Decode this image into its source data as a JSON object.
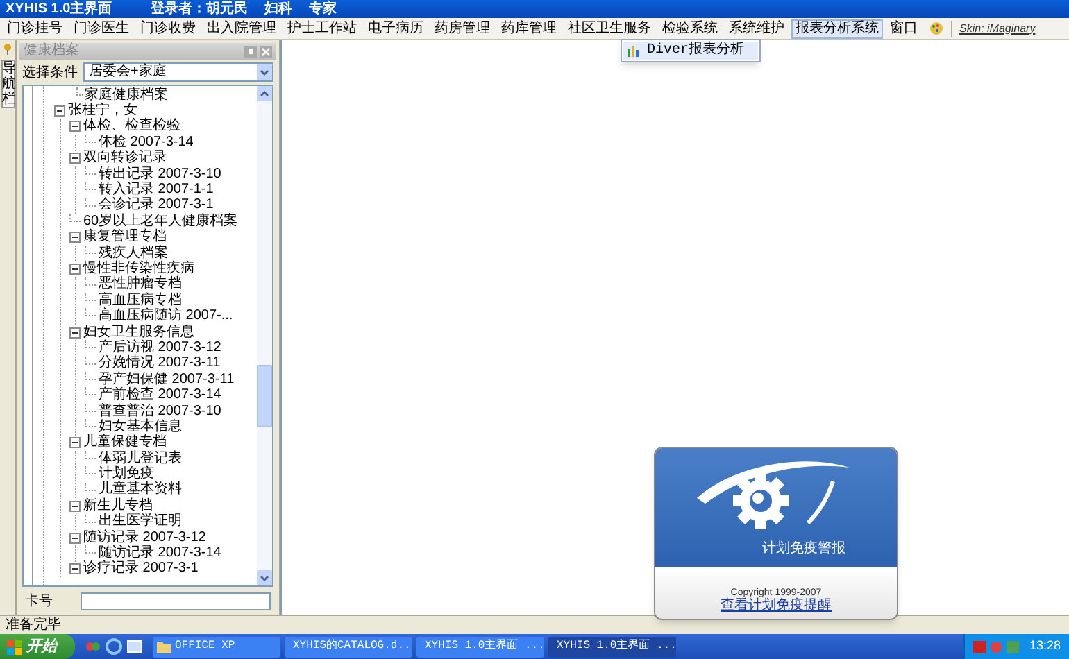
{
  "window": {
    "title": "XYHIS 1.0主界面",
    "login": "登录者：胡元民",
    "department": "妇科",
    "role": "专家"
  },
  "menu": [
    {
      "label": "门诊挂号",
      "selected": false
    },
    {
      "label": "门诊医生",
      "selected": false
    },
    {
      "label": "门诊收费",
      "selected": false
    },
    {
      "label": "出入院管理",
      "selected": false
    },
    {
      "label": "护士工作站",
      "selected": false
    },
    {
      "label": "电子病历",
      "selected": false
    },
    {
      "label": "药房管理",
      "selected": false
    },
    {
      "label": "药库管理",
      "selected": false
    },
    {
      "label": "社区卫生服务",
      "selected": false
    },
    {
      "label": "检验系统",
      "selected": false
    },
    {
      "label": "系统维护",
      "selected": false
    },
    {
      "label": "报表分析系统",
      "selected": true
    },
    {
      "label": "窗口",
      "selected": false
    }
  ],
  "skin_link": "Skin: iMaginary",
  "dropdown": {
    "items": [
      {
        "label": "Diver报表分析"
      }
    ]
  },
  "side_strip": {
    "label": "导航栏"
  },
  "panel": {
    "title": "健康档案",
    "condition_label": "选择条件",
    "condition_value": "居委会+家庭",
    "tree_tail": "家庭健康档案",
    "tree": [
      {
        "label": "张桂宁，女",
        "expanded": true,
        "children": [
          {
            "label": "体检、检查检验",
            "expanded": true,
            "children": [
              {
                "label": "体检 2007-3-14"
              }
            ]
          },
          {
            "label": "双向转诊记录",
            "expanded": true,
            "children": [
              {
                "label": "转出记录 2007-3-10"
              },
              {
                "label": "转入记录 2007-1-1"
              },
              {
                "label": "会诊记录 2007-3-1"
              }
            ]
          },
          {
            "label": "60岁以上老年人健康档案"
          },
          {
            "label": "康复管理专档",
            "expanded": true,
            "children": [
              {
                "label": "残疾人档案"
              }
            ]
          },
          {
            "label": "慢性非传染性疾病",
            "expanded": true,
            "children": [
              {
                "label": "恶性肿瘤专档"
              },
              {
                "label": "高血压病专档"
              },
              {
                "label": "高血压病随访 2007-..."
              }
            ]
          },
          {
            "label": "妇女卫生服务信息",
            "expanded": true,
            "children": [
              {
                "label": "产后访视 2007-3-12"
              },
              {
                "label": "分娩情况 2007-3-11"
              },
              {
                "label": "孕产妇保健 2007-3-11"
              },
              {
                "label": "产前检查 2007-3-14"
              },
              {
                "label": "普查普治 2007-3-10"
              },
              {
                "label": "妇女基本信息"
              }
            ]
          },
          {
            "label": "儿童保健专档",
            "expanded": true,
            "children": [
              {
                "label": "体弱儿登记表"
              },
              {
                "label": "计划免疫"
              },
              {
                "label": "儿童基本资料"
              }
            ]
          },
          {
            "label": "新生儿专档",
            "expanded": true,
            "children": [
              {
                "label": "出生医学证明"
              }
            ]
          },
          {
            "label": "随访记录 2007-3-12",
            "expanded": true,
            "children": [
              {
                "label": "随访记录 2007-3-14"
              }
            ]
          },
          {
            "label": "诊疗记录 2007-3-1",
            "expanded": true
          }
        ]
      }
    ],
    "card_label": "卡号"
  },
  "splash": {
    "title": "计划免疫警报",
    "copyright": "Copyright  1999-2007",
    "link": "查看计划免疫提醒"
  },
  "status_bar": "准备完毕",
  "taskbar": {
    "start": "开始",
    "tasks": [
      {
        "label": "OFFICE XP",
        "kind": "folder",
        "selected": false
      },
      {
        "label": "XYHIS的CATALOG.d...",
        "kind": "document",
        "selected": false
      },
      {
        "label": "XYHIS 1.0主界面 ...",
        "kind": "app",
        "selected": false
      },
      {
        "label": "XYHIS 1.0主界面 ...",
        "kind": "app",
        "selected": true
      }
    ],
    "clock": "13:28"
  }
}
